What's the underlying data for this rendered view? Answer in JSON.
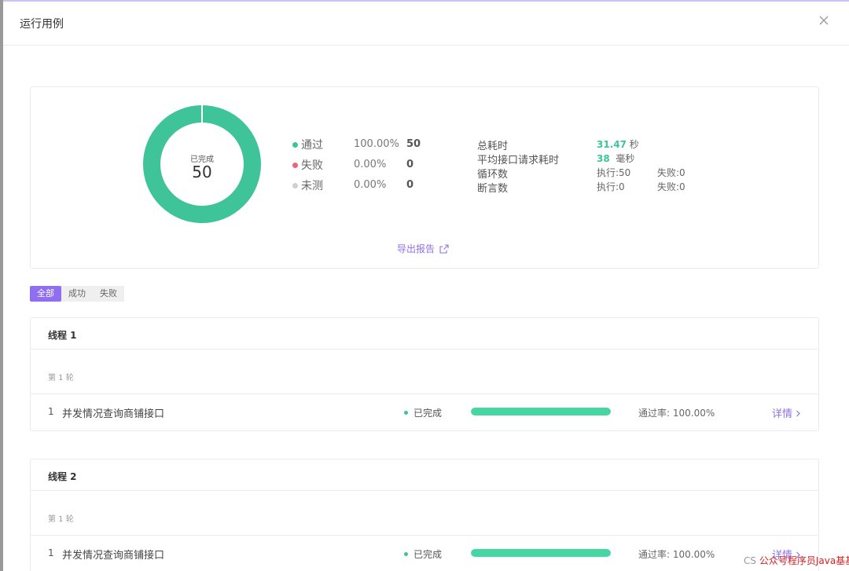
{
  "modal": {
    "title": "运行用例"
  },
  "summary": {
    "donut_label": "已完成",
    "donut_count": "50",
    "pass_fraction": 1.0,
    "legend": [
      {
        "name": "通过",
        "percent": "100.00%",
        "count": "50",
        "color": "#3fc49a"
      },
      {
        "name": "失败",
        "percent": "0.00%",
        "count": "0",
        "color": "#f0607a"
      },
      {
        "name": "未测",
        "percent": "0.00%",
        "count": "0",
        "color": "#d0d0d0"
      }
    ],
    "stats": {
      "total_time_label": "总耗时",
      "total_time_value": "31.47",
      "total_time_unit": "秒",
      "avg_time_label": "平均接口请求耗时",
      "avg_time_value": "38",
      "avg_time_unit": "毫秒",
      "loop_label": "循环数",
      "loop_exec": "执行:50",
      "loop_fail": "失败:0",
      "assert_label": "断言数",
      "assert_exec": "执行:0",
      "assert_fail": "失败:0"
    },
    "export_label": "导出报告"
  },
  "filter_tabs": [
    {
      "label": "全部",
      "active": true
    },
    {
      "label": "成功",
      "active": false
    },
    {
      "label": "失败",
      "active": false
    }
  ],
  "threads": [
    {
      "title": "线程 1",
      "round": "第 1 轮",
      "case": {
        "index": "1",
        "name": "并发情况查询商铺接口",
        "status": "已完成",
        "progress": 1.0,
        "rate": "通过率: 100.00%",
        "detail": "详情"
      }
    },
    {
      "title": "线程 2",
      "round": "第 1 轮",
      "case": {
        "index": "1",
        "name": "并发情况查询商铺接口",
        "status": "已完成",
        "progress": 1.0,
        "rate": "通过率: 100.00%",
        "detail": "详情"
      }
    }
  ],
  "watermark": {
    "prefix": "CS",
    "text": "公众号程序员Java基基"
  }
}
